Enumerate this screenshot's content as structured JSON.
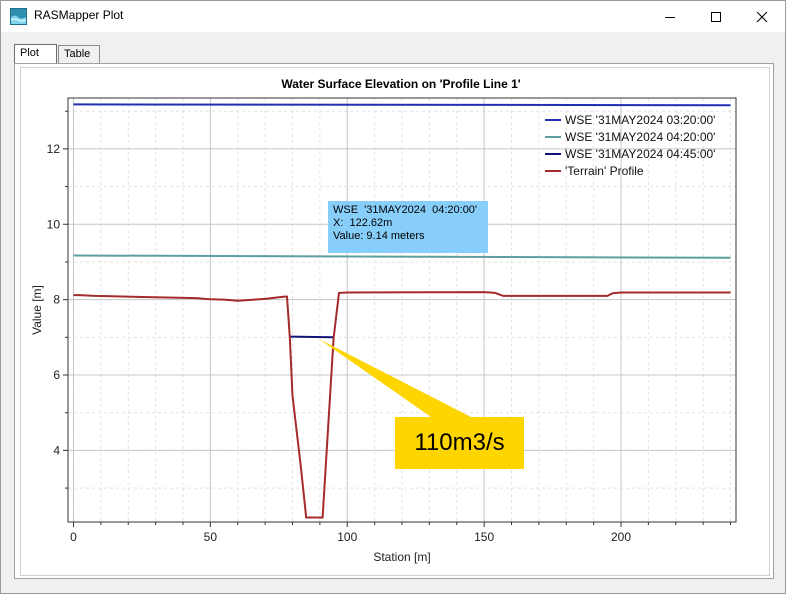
{
  "window": {
    "title": "RASMapper Plot",
    "controls": {
      "minimize": "minimize-icon",
      "maximize": "maximize-icon",
      "close": "close-icon"
    }
  },
  "tabs": [
    {
      "label": "Plot",
      "active": true
    },
    {
      "label": "Table",
      "active": false
    }
  ],
  "tooltip": {
    "line1": "WSE  '31MAY2024  04:20:00'",
    "line2": "X:  122.62m",
    "line3": "Value: 9.14 meters"
  },
  "callout": {
    "text": "110m3/s",
    "color": "#ffd500"
  },
  "chart_data": {
    "type": "line",
    "title": "Water Surface Elevation on 'Profile Line 1'",
    "xlabel": "Station [m]",
    "ylabel": "Value [m]",
    "xlim": [
      -2,
      242
    ],
    "ylim": [
      2.1,
      13.35
    ],
    "xticks": [
      0,
      50,
      100,
      150,
      200
    ],
    "yticks": [
      4,
      6,
      8,
      10,
      12
    ],
    "grid": true,
    "legend_position": "top-right",
    "series": [
      {
        "name": "WSE '31MAY2024 03:20:00'",
        "color": "#1f2fb4",
        "x": [
          0,
          240
        ],
        "y": [
          13.18,
          13.16
        ]
      },
      {
        "name": "WSE '31MAY2024 04:20:00'",
        "color": "#5f9ea0",
        "x": [
          0,
          240
        ],
        "y": [
          9.17,
          9.11
        ]
      },
      {
        "name": "WSE '31MAY2024 04:45:00'",
        "color": "#141478",
        "x": [
          79,
          95
        ],
        "y": [
          7.02,
          7.0
        ]
      },
      {
        "name": "'Terrain' Profile",
        "color": "#a52a2a",
        "x": [
          0,
          2,
          8,
          25,
          45,
          48,
          50,
          55,
          60,
          70,
          77,
          78,
          79,
          80,
          83,
          85,
          88,
          91,
          95,
          97,
          100,
          150,
          154,
          157,
          160,
          193,
          195,
          197,
          200,
          240
        ],
        "y": [
          8.12,
          8.12,
          8.1,
          8.07,
          8.04,
          8.02,
          8.01,
          8.0,
          7.97,
          8.02,
          8.08,
          8.08,
          7.0,
          5.45,
          3.6,
          2.22,
          2.22,
          2.22,
          6.98,
          8.18,
          8.19,
          8.2,
          8.18,
          8.1,
          8.1,
          8.1,
          8.1,
          8.17,
          8.19,
          8.19
        ]
      }
    ]
  }
}
